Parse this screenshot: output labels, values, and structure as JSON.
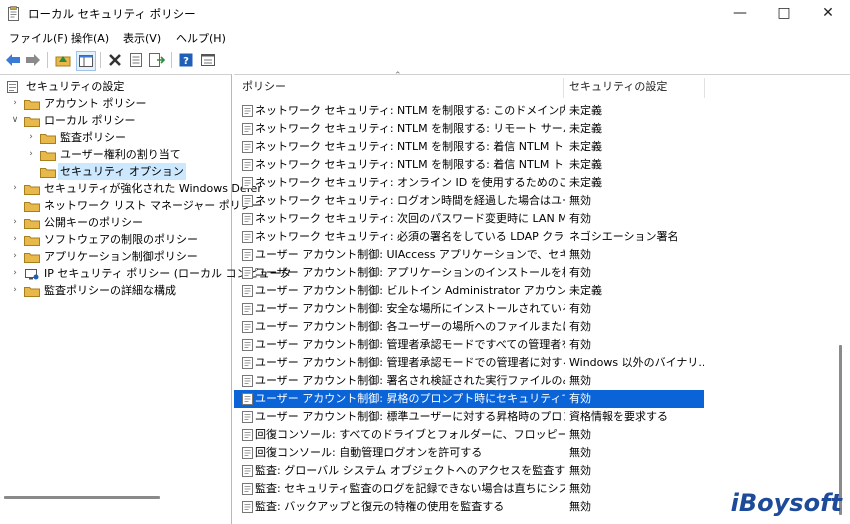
{
  "window": {
    "title": "ローカル セキュリティ ポリシー",
    "minimize_icon": "minimize-icon",
    "maximize_icon": "maximize-icon",
    "close_icon": "close-icon"
  },
  "menu": [
    "ファイル(F)",
    "操作(A)",
    "表示(V)",
    "ヘルプ(H)"
  ],
  "toolbar": [
    "back-arrow-icon",
    "forward-arrow-icon",
    "up-folder-icon",
    "show-hide-tree-icon",
    "delete-icon",
    "properties-icon",
    "export-list-icon",
    "help-icon",
    "view-icon"
  ],
  "tree": [
    {
      "label": "セキュリティの設定",
      "indent": 0,
      "chevron": "",
      "icon": "security-settings-icon"
    },
    {
      "label": "アカウント ポリシー",
      "indent": 1,
      "chevron": ">",
      "icon": "folder-icon"
    },
    {
      "label": "ローカル ポリシー",
      "indent": 1,
      "chevron": "v",
      "icon": "folder-icon"
    },
    {
      "label": "監査ポリシー",
      "indent": 2,
      "chevron": ">",
      "icon": "folder-icon"
    },
    {
      "label": "ユーザー権利の割り当て",
      "indent": 2,
      "chevron": ">",
      "icon": "folder-icon"
    },
    {
      "label": "セキュリティ オプション",
      "indent": 2,
      "chevron": "",
      "icon": "folder-icon",
      "selected": true
    },
    {
      "label": "セキュリティが強化された Windows Defer",
      "indent": 1,
      "chevron": ">",
      "icon": "folder-icon"
    },
    {
      "label": "ネットワーク リスト マネージャー ポリシー",
      "indent": 1,
      "chevron": "",
      "icon": "folder-icon"
    },
    {
      "label": "公開キーのポリシー",
      "indent": 1,
      "chevron": ">",
      "icon": "folder-icon"
    },
    {
      "label": "ソフトウェアの制限のポリシー",
      "indent": 1,
      "chevron": ">",
      "icon": "folder-icon"
    },
    {
      "label": "アプリケーション制御ポリシー",
      "indent": 1,
      "chevron": ">",
      "icon": "folder-icon"
    },
    {
      "label": "IP セキュリティ ポリシー (ローカル コンピュータ",
      "indent": 1,
      "chevron": ">",
      "icon": "ip-security-icon"
    },
    {
      "label": "監査ポリシーの詳細な構成",
      "indent": 1,
      "chevron": ">",
      "icon": "folder-icon"
    }
  ],
  "columns": {
    "policy": "ポリシー",
    "setting": "セキュリティの設定"
  },
  "rows": [
    {
      "policy": "ネットワーク セキュリティ: NTLM を制限する: このドメイン内の NTLM ...",
      "setting": "未定義"
    },
    {
      "policy": "ネットワーク セキュリティ: NTLM を制限する: リモート サーバーに対する...",
      "setting": "未定義"
    },
    {
      "policy": "ネットワーク セキュリティ: NTLM を制限する: 着信 NTLM トラフィック",
      "setting": "未定義"
    },
    {
      "policy": "ネットワーク セキュリティ: NTLM を制限する: 着信 NTLM トラフィック...",
      "setting": "未定義"
    },
    {
      "policy": "ネットワーク セキュリティ: オンライン ID を使用するためのこのコンピュー...",
      "setting": "未定義"
    },
    {
      "policy": "ネットワーク セキュリティ: ログオン時間を経過した場合はユーザーを強...",
      "setting": "無効"
    },
    {
      "policy": "ネットワーク セキュリティ: 次回のパスワード変更時に LAN Manager ...",
      "setting": "有効"
    },
    {
      "policy": "ネットワーク セキュリティ: 必須の署名をしている LDAP クライアント",
      "setting": "ネゴシエーション署名"
    },
    {
      "policy": "ユーザー アカウント制御: UIAccess アプリケーションで、セキュリティで...",
      "setting": "無効"
    },
    {
      "policy": "ユーザー アカウント制御: アプリケーションのインストールを検出し、昇...",
      "setting": "有効"
    },
    {
      "policy": "ユーザー アカウント制御: ビルトイン Administrator アカウントのための...",
      "setting": "未定義"
    },
    {
      "policy": "ユーザー アカウント制御: 安全な場所にインストールされている UIAcc...",
      "setting": "有効"
    },
    {
      "policy": "ユーザー アカウント制御: 各ユーザーの場所へのファイルまたはレジスト...",
      "setting": "有効"
    },
    {
      "policy": "ユーザー アカウント制御: 管理者承認モードですべての管理者を実行...",
      "setting": "有効"
    },
    {
      "policy": "ユーザー アカウント制御: 管理者承認モードでの管理者に対する昇...",
      "setting": "Windows 以外のバイナリ..."
    },
    {
      "policy": "ユーザー アカウント制御: 署名され検証された実行ファイルのみを昇...",
      "setting": "無効"
    },
    {
      "policy": "ユーザー アカウント制御: 昇格のプロンプト時にセキュリティで保護され...",
      "setting": "有効",
      "selected": true
    },
    {
      "policy": "ユーザー アカウント制御: 標準ユーザーに対する昇格時のプロンプトの...",
      "setting": "資格情報を要求する"
    },
    {
      "policy": "回復コンソール: すべてのドライブとフォルダーに、フロッピーのコピーとア...",
      "setting": "無効"
    },
    {
      "policy": "回復コンソール: 自動管理ログオンを許可する",
      "setting": "無効"
    },
    {
      "policy": "監査: グローバル システム オブジェクトへのアクセスを監査する",
      "setting": "無効"
    },
    {
      "policy": "監査: セキュリティ監査のログを記録できない場合は直ちにシステムを...",
      "setting": "無効"
    },
    {
      "policy": "監査: バックアップと復元の特権の使用を監査する",
      "setting": "無効"
    }
  ],
  "watermark": "iBoysoft",
  "colors": {
    "selection": "#0a64d8",
    "tree_selection": "#cce8ff",
    "folder": "#e8b84a"
  }
}
